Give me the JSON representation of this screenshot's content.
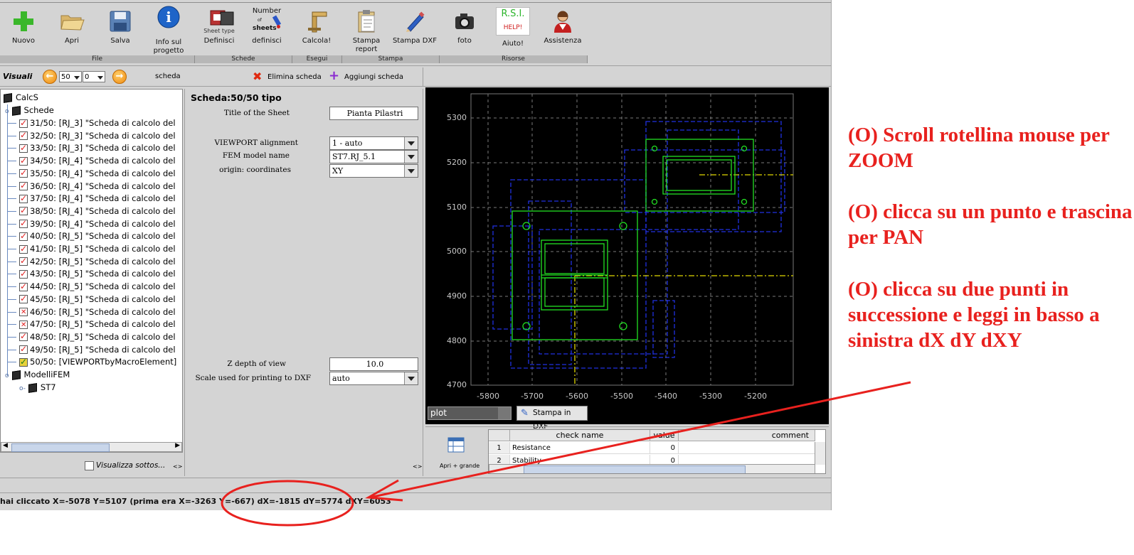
{
  "toolbar": {
    "buttons": [
      {
        "label": "Nuovo",
        "icon": "plus-icon"
      },
      {
        "label": "Apri",
        "icon": "folder-open-icon"
      },
      {
        "label": "Salva",
        "icon": "floppy-disk-icon"
      },
      {
        "label": "Info sul progetto",
        "icon": "info-icon"
      },
      {
        "label": "Definisci",
        "icon": "sheet-type-icon",
        "sublabel": "Sheet type"
      },
      {
        "label": "definisci",
        "icon": "number-of-sheets-icon",
        "sublabel": "Number of sheets"
      },
      {
        "label": "Calcola!",
        "icon": "calculate-icon"
      },
      {
        "label": "Stampa report",
        "icon": "clipboard-report-icon"
      },
      {
        "label": "Stampa DXF",
        "icon": "pencil-icon"
      },
      {
        "label": "foto",
        "icon": "camera-icon"
      },
      {
        "label": "Aiuto!",
        "icon": "rsi-help-icon",
        "badge": "R.S.I.",
        "badge2": "HELP!"
      },
      {
        "label": "Assistenza",
        "icon": "support-person-icon"
      }
    ],
    "groups": [
      "File",
      "Schede",
      "Esegui",
      "Stampa",
      "Risorse"
    ]
  },
  "nav": {
    "visuali": "Visuali",
    "spin1": "50",
    "spin2": "0",
    "scheda": "scheda",
    "elimina": "Elimina scheda",
    "aggiungi": "Aggiungi scheda"
  },
  "tree": {
    "root": "CalcS",
    "schede": "Schede",
    "items": [
      {
        "text": "31/50: [RJ_3] \"Scheda di calcolo del",
        "mark": "check"
      },
      {
        "text": "32/50: [RJ_3] \"Scheda di calcolo del",
        "mark": "check"
      },
      {
        "text": "33/50: [RJ_3] \"Scheda di calcolo del",
        "mark": "check"
      },
      {
        "text": "34/50: [RJ_4] \"Scheda di calcolo del",
        "mark": "check"
      },
      {
        "text": "35/50: [RJ_4] \"Scheda di calcolo del",
        "mark": "check"
      },
      {
        "text": "36/50: [RJ_4] \"Scheda di calcolo del",
        "mark": "check"
      },
      {
        "text": "37/50: [RJ_4] \"Scheda di calcolo del",
        "mark": "check"
      },
      {
        "text": "38/50: [RJ_4] \"Scheda di calcolo del",
        "mark": "check"
      },
      {
        "text": "39/50: [RJ_4] \"Scheda di calcolo del",
        "mark": "check"
      },
      {
        "text": "40/50: [RJ_5] \"Scheda di calcolo del",
        "mark": "check"
      },
      {
        "text": "41/50: [RJ_5] \"Scheda di calcolo del",
        "mark": "check"
      },
      {
        "text": "42/50: [RJ_5] \"Scheda di calcolo del",
        "mark": "check"
      },
      {
        "text": "43/50: [RJ_5] \"Scheda di calcolo del",
        "mark": "check"
      },
      {
        "text": "44/50: [RJ_5] \"Scheda di calcolo del",
        "mark": "check"
      },
      {
        "text": "45/50: [RJ_5] \"Scheda di calcolo del",
        "mark": "check"
      },
      {
        "text": "46/50: [RJ_5] \"Scheda di calcolo del",
        "mark": "cross"
      },
      {
        "text": "47/50: [RJ_5] \"Scheda di calcolo del",
        "mark": "cross"
      },
      {
        "text": "48/50: [RJ_5] \"Scheda di calcolo del",
        "mark": "check"
      },
      {
        "text": "49/50: [RJ_5] \"Scheda di calcolo del",
        "mark": "check"
      },
      {
        "text": "50/50: [VIEWPORTbyMacroElement]",
        "mark": "yellow"
      }
    ],
    "modelli": "ModelliFEM",
    "st7": "ST7",
    "visualizza": "Visualizza sottos...",
    "arrows": "<>"
  },
  "form": {
    "title": "Scheda:50/50 tipo",
    "title_label": "Title of the Sheet",
    "title_value": "Pianta Pilastri",
    "viewport_label": "VIEWPORT alignment",
    "viewport_value": "1 - auto",
    "fem_label": "FEM model name",
    "fem_value": "ST7.RJ_5.1",
    "origin_label": "origin: coordinates",
    "origin_value": "XY",
    "zdepth_label": "Z depth of view",
    "zdepth_value": "10.0",
    "scale_label": "Scale used for printing to DXF",
    "scale_value": "auto",
    "arrows": "<>"
  },
  "plot": {
    "y_ticks": [
      "5300",
      "5200",
      "5100",
      "5000",
      "4900",
      "4800",
      "4700"
    ],
    "x_ticks": [
      "-5800",
      "-5700",
      "-5600",
      "-5500",
      "-5400",
      "-5300",
      "-5200"
    ],
    "mode_value": "plot",
    "stampa_dxf": "Stampa in DXF"
  },
  "checks": {
    "side_label": "Apri + grande",
    "headers": [
      "",
      "check name",
      "value",
      "comment"
    ],
    "rows": [
      {
        "n": "1",
        "name": "Resistance",
        "value": "0",
        "comment": ""
      },
      {
        "n": "2",
        "name": "Stability",
        "value": "0",
        "comment": ""
      }
    ]
  },
  "status": "hai cliccato X=-5078 Y=5107 (prima era X=-3263 Y=-667) dX=-1815 dY=5774 dXY=6053",
  "annotations": {
    "p1": "(O) Scroll rotellina mouse per ZOOM",
    "p2": "(O) clicca su un punto e trascina per PAN",
    "p3": "(O) clicca su due punti in successione e leggi in basso a sinistra dX dY dXY"
  },
  "colors": {
    "annotation_red": "#e8211e",
    "plot_green": "#22e022",
    "plot_blue": "#2030e0",
    "plot_yellow": "#e0d800"
  }
}
